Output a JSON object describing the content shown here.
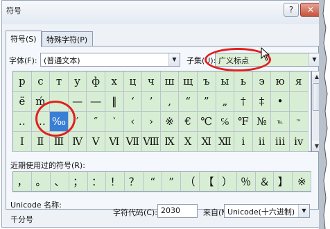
{
  "window": {
    "title": "符号",
    "help": "?",
    "close": "✕"
  },
  "tabs": [
    {
      "label": "符号(S)"
    },
    {
      "label": "特殊字符(P)"
    }
  ],
  "font": {
    "label": "字体(F):",
    "value": "(普通文本)"
  },
  "subset": {
    "label": "子集(U):",
    "value": "广义标点"
  },
  "symbol_grid": [
    [
      "р",
      "с",
      "т",
      "у",
      "ф",
      "х",
      "ц",
      "ч",
      "ш",
      "щ",
      "ъ",
      "ы",
      "ь",
      "э",
      "ю",
      "я"
    ],
    [
      "ё",
      "ḿ",
      "–",
      "—",
      "―",
      "‖",
      "‘",
      "’",
      "‚",
      "“",
      "”",
      "„",
      "†",
      "‡",
      "•",
      ""
    ],
    [
      "‥",
      "…",
      "‰",
      "′",
      "″",
      "‵",
      "‹",
      "›",
      "※",
      "€",
      "℃",
      "℅",
      "℉",
      "№",
      "℡",
      "™"
    ],
    [
      "Ⅰ",
      "Ⅱ",
      "Ⅲ",
      "Ⅳ",
      "Ⅴ",
      "Ⅵ",
      "Ⅶ",
      "Ⅷ",
      "Ⅸ",
      "Ⅹ",
      "Ⅺ",
      "Ⅻ",
      "ⅰ",
      "ⅱ",
      "ⅲ",
      "ⅳ"
    ]
  ],
  "selected": {
    "row": 2,
    "col": 2,
    "symbol": "‰"
  },
  "recent": {
    "label": "近期使用过的符号(R):",
    "symbols": [
      "，",
      "。",
      "、",
      "；",
      "：",
      "！",
      "？",
      "“",
      "”",
      "（",
      "【",
      "）",
      "％",
      "＆",
      "】",
      "※"
    ]
  },
  "unicode": {
    "label": "Unicode 名称:",
    "name": "千分号"
  },
  "charcode": {
    "label": "字符代码(C):",
    "value": "2030"
  },
  "from": {
    "label": "来自(M):",
    "value": "Unicode(十六进制)"
  },
  "colors": {
    "cell_bg": "#d8eed4",
    "selected_bg": "#3a7fd6",
    "highlight": "#e0201f"
  }
}
